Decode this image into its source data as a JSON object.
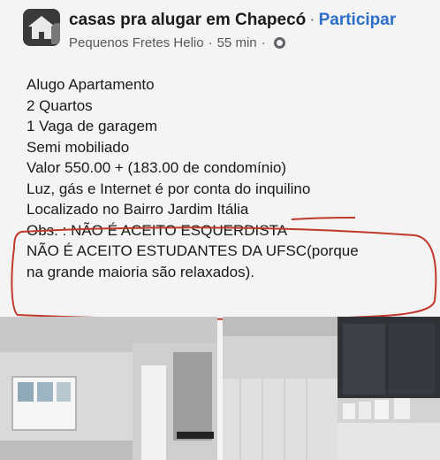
{
  "post": {
    "group_name": "casas pra alugar em Chapecó",
    "separator": "·",
    "join_label": "Participar",
    "author": "Pequenos Fretes Helio",
    "time": "55 min",
    "privacy_icon": "globe-icon"
  },
  "content": {
    "lines": [
      "Alugo Apartamento",
      "2 Quartos",
      "1 Vaga de garagem",
      "Semi mobiliado",
      "Valor 550.00 + (183.00 de condomínio)",
      "Luz, gás e Internet é por conta do inquilino",
      "Localizado no Bairro Jardim Itália",
      "Obs. : NÃO É ACEITO ESQUERDISTA",
      "NÃO É ACEITO ESTUDANTES DA UFSC(porque",
      "na grande maioria são relaxados)."
    ]
  },
  "colors": {
    "accent": "#2d6fc7",
    "annotation": "#c0392b"
  }
}
